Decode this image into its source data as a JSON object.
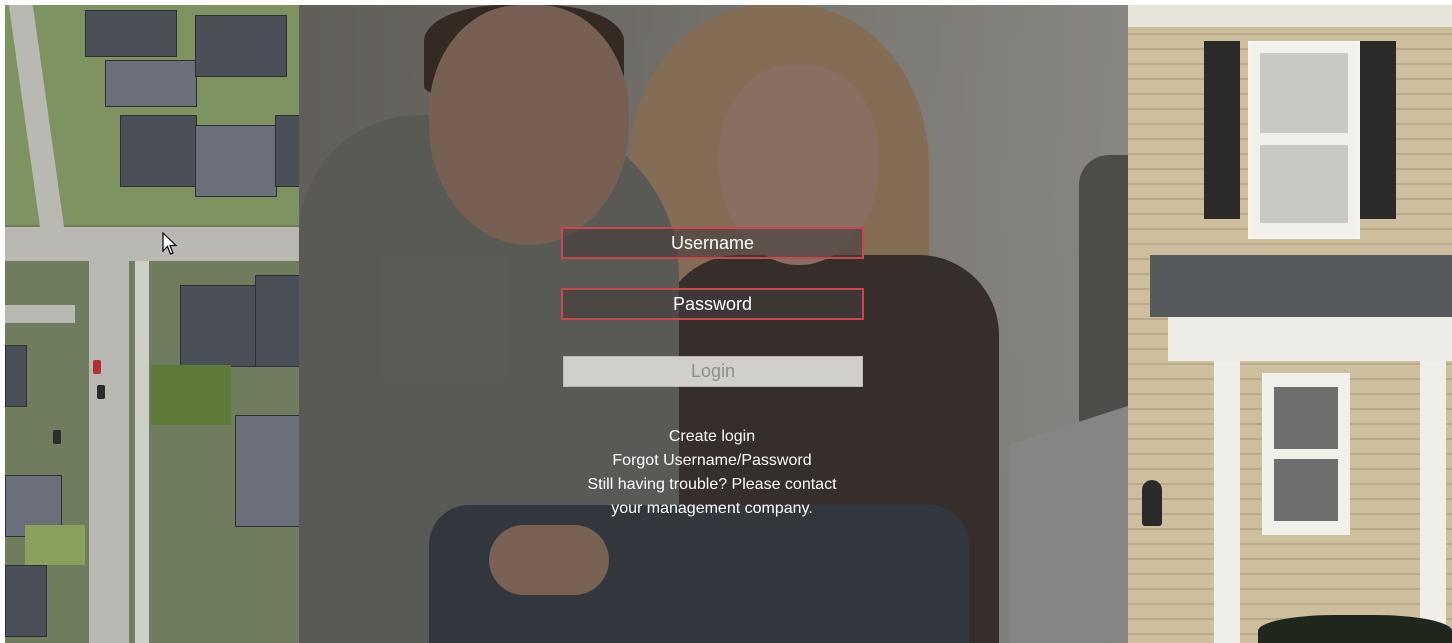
{
  "login": {
    "username_placeholder": "Username",
    "password_placeholder": "Password",
    "login_label": "Login"
  },
  "links": {
    "create_login": "Create login",
    "forgot": "Forgot Username/Password",
    "trouble_line1": "Still having trouble? Please contact",
    "trouble_line2": "your management company."
  },
  "colors": {
    "field_border": "#c9474e",
    "button_bg": "#d0cfcc",
    "button_text": "#8f8e8b"
  },
  "icons": [
    "mouse-cursor-icon"
  ]
}
